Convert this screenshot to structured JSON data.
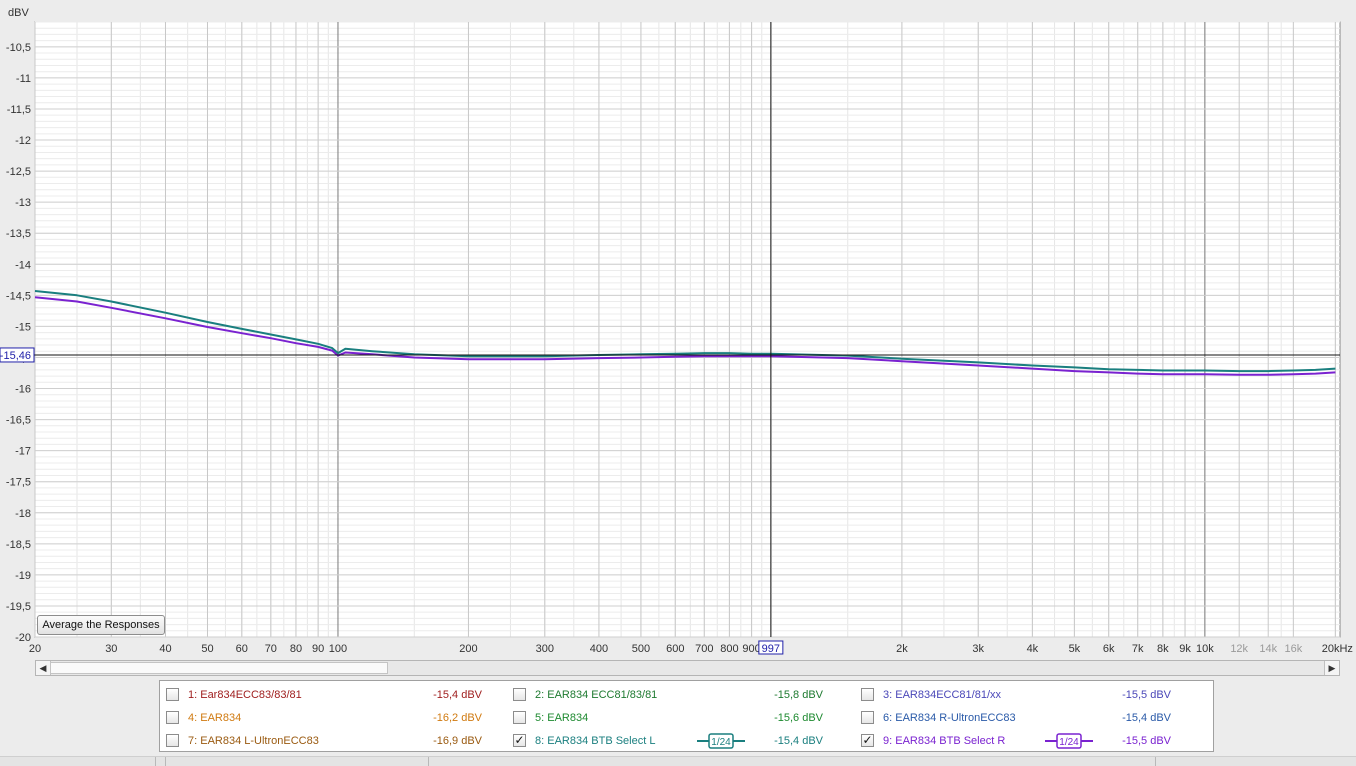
{
  "chart_data": {
    "type": "line",
    "ylabel": "dBV",
    "x_unit_label": "kHz",
    "x_scale": "log",
    "xlim": [
      20,
      20500
    ],
    "ylim": [
      -20,
      -10.1
    ],
    "y_ticks": [
      "-10,5",
      "-11",
      "-11,5",
      "-12",
      "-12,5",
      "-13",
      "-13,5",
      "-14",
      "-14,5",
      "-15",
      "-15,5",
      "-16",
      "-16,5",
      "-17",
      "-17,5",
      "-18",
      "-18,5",
      "-19",
      "-19,5",
      "-20"
    ],
    "x_ticks": [
      {
        "v": 20,
        "label": "20"
      },
      {
        "v": 30,
        "label": "30"
      },
      {
        "v": 40,
        "label": "40"
      },
      {
        "v": 50,
        "label": "50"
      },
      {
        "v": 60,
        "label": "60"
      },
      {
        "v": 70,
        "label": "70"
      },
      {
        "v": 80,
        "label": "80"
      },
      {
        "v": 90,
        "label": "90"
      },
      {
        "v": 100,
        "label": "100"
      },
      {
        "v": 200,
        "label": "200"
      },
      {
        "v": 300,
        "label": "300"
      },
      {
        "v": 400,
        "label": "400"
      },
      {
        "v": 500,
        "label": "500"
      },
      {
        "v": 600,
        "label": "600"
      },
      {
        "v": 700,
        "label": "700"
      },
      {
        "v": 800,
        "label": "800"
      },
      {
        "v": 900,
        "label": "900"
      },
      {
        "v": 2000,
        "label": "2k"
      },
      {
        "v": 3000,
        "label": "3k"
      },
      {
        "v": 4000,
        "label": "4k"
      },
      {
        "v": 5000,
        "label": "5k"
      },
      {
        "v": 6000,
        "label": "6k"
      },
      {
        "v": 7000,
        "label": "7k"
      },
      {
        "v": 8000,
        "label": "8k"
      },
      {
        "v": 9000,
        "label": "9k"
      },
      {
        "v": 10000,
        "label": "10k"
      },
      {
        "v": 12000,
        "label": "12k"
      },
      {
        "v": 14000,
        "label": "14k"
      },
      {
        "v": 16000,
        "label": "16k"
      },
      {
        "v": 20000,
        "label": "20kHz"
      }
    ],
    "cursor": {
      "x": 997,
      "x_label": "997",
      "y": -15.46,
      "y_label": "-15,46"
    },
    "grid": true,
    "series": [
      {
        "name": "8: EAR834 BTB Select L",
        "color": "#1a7f7f",
        "x": [
          20,
          25,
          30,
          40,
          50,
          60,
          70,
          80,
          90,
          97,
          100,
          104,
          120,
          150,
          200,
          300,
          400,
          500,
          600,
          700,
          800,
          900,
          1000,
          1500,
          2000,
          3000,
          4000,
          5000,
          6000,
          7000,
          8000,
          10000,
          12000,
          14000,
          16000,
          18000,
          20000
        ],
        "y": [
          -14.43,
          -14.5,
          -14.6,
          -14.78,
          -14.93,
          -15.04,
          -15.13,
          -15.21,
          -15.28,
          -15.35,
          -15.43,
          -15.36,
          -15.4,
          -15.45,
          -15.48,
          -15.48,
          -15.46,
          -15.45,
          -15.44,
          -15.43,
          -15.43,
          -15.44,
          -15.44,
          -15.47,
          -15.52,
          -15.58,
          -15.63,
          -15.66,
          -15.69,
          -15.7,
          -15.71,
          -15.71,
          -15.72,
          -15.72,
          -15.71,
          -15.7,
          -15.68
        ]
      },
      {
        "name": "9: EAR834 BTB Select R",
        "color": "#7a22d0",
        "x": [
          20,
          25,
          30,
          40,
          50,
          60,
          70,
          80,
          90,
          97,
          100,
          104,
          120,
          150,
          200,
          300,
          400,
          500,
          600,
          700,
          800,
          900,
          1000,
          1500,
          2000,
          3000,
          4000,
          5000,
          6000,
          7000,
          8000,
          10000,
          12000,
          14000,
          16000,
          18000,
          20000
        ],
        "y": [
          -14.53,
          -14.6,
          -14.7,
          -14.87,
          -15.01,
          -15.11,
          -15.19,
          -15.27,
          -15.33,
          -15.39,
          -15.47,
          -15.42,
          -15.45,
          -15.5,
          -15.53,
          -15.53,
          -15.51,
          -15.5,
          -15.49,
          -15.48,
          -15.48,
          -15.48,
          -15.48,
          -15.51,
          -15.56,
          -15.63,
          -15.68,
          -15.72,
          -15.74,
          -15.76,
          -15.77,
          -15.77,
          -15.78,
          -15.78,
          -15.77,
          -15.76,
          -15.74
        ]
      }
    ]
  },
  "buttons": {
    "average": "Average the Responses"
  },
  "legend": [
    {
      "label": "1: Ear834ECC83/83/81",
      "value": "-15,4 dBV",
      "color": "#a02020",
      "checked": false
    },
    {
      "label": "2: EAR834 ECC81/83/81",
      "value": "-15,8 dBV",
      "color": "#1e7a30",
      "checked": false
    },
    {
      "label": "3: EAR834ECC81/81/xx",
      "value": "-15,5 dBV",
      "color": "#4a47b8",
      "checked": false
    },
    {
      "label": "4: EAR834",
      "value": "-16,2 dBV",
      "color": "#d07a10",
      "checked": false
    },
    {
      "label": "5: EAR834",
      "value": "-15,6 dBV",
      "color": "#1e8a30",
      "checked": false
    },
    {
      "label": "6: EAR834 R-UltronECC83",
      "value": "-15,4 dBV",
      "color": "#2a5aa8",
      "checked": false
    },
    {
      "label": "7: EAR834 L-UltronECC83",
      "value": "-16,9 dBV",
      "color": "#9a5a10",
      "checked": false
    },
    {
      "label": "8: EAR834 BTB Select L",
      "value": "-15,4 dBV",
      "color": "#1a7f7f",
      "checked": true,
      "smoothing": "1/24"
    },
    {
      "label": "9: EAR834 BTB Select R",
      "value": "-15,5 dBV",
      "color": "#7a22d0",
      "checked": true,
      "smoothing": "1/24"
    }
  ],
  "icons": {
    "scroll_left": "scroll-left-icon",
    "scroll_right": "scroll-right-icon",
    "checkbox": "checkmark-icon"
  },
  "checkmark_glyph": "✓"
}
